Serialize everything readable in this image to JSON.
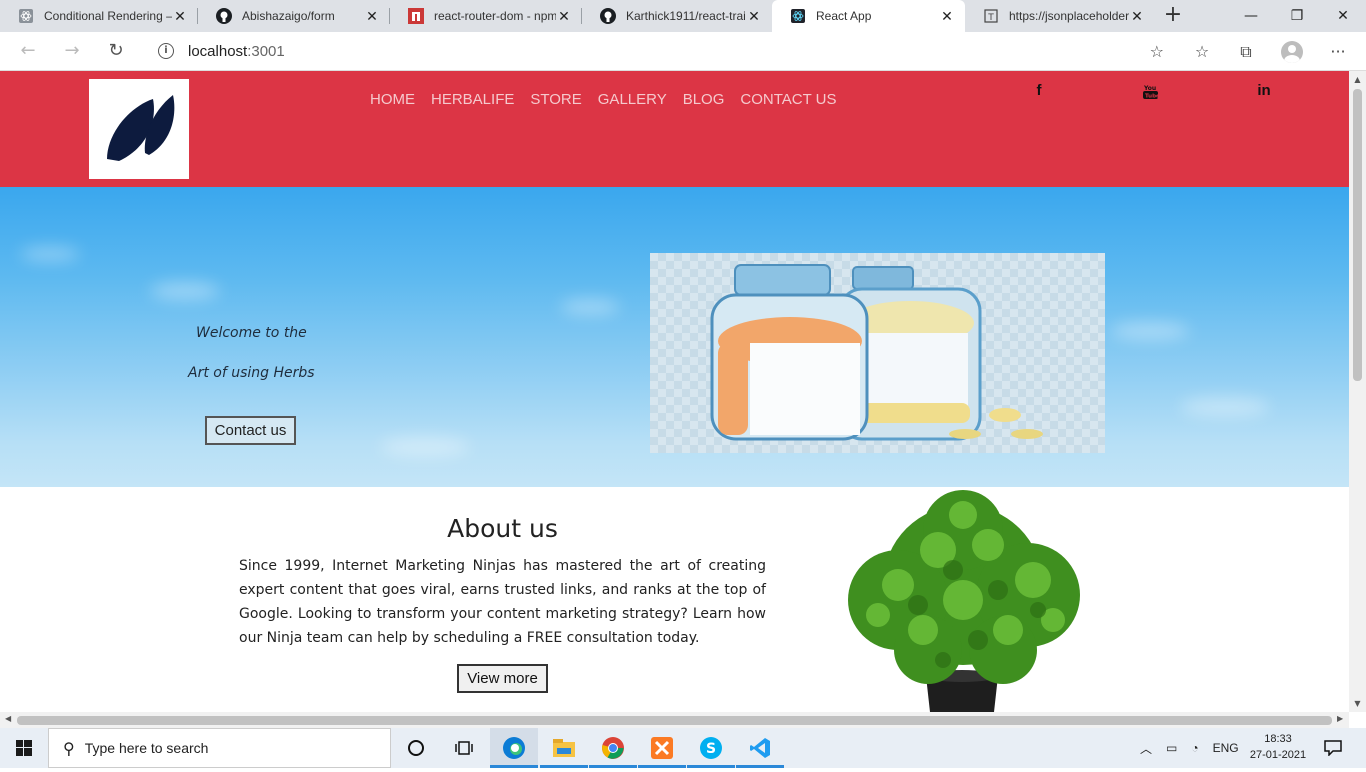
{
  "browser": {
    "tabs": [
      {
        "title": "Conditional Rendering –",
        "favicon": "react-icon"
      },
      {
        "title": "Abishazaigo/form",
        "favicon": "github-icon"
      },
      {
        "title": "react-router-dom - npm",
        "favicon": "npm-icon"
      },
      {
        "title": "Karthick1911/react-trai",
        "favicon": "github-icon"
      },
      {
        "title": "React App",
        "favicon": "react-icon"
      },
      {
        "title": "https://jsonplaceholder.",
        "favicon": "page-icon"
      }
    ],
    "active_tab_index": 4,
    "url_host": "localhost",
    "url_port": ":3001"
  },
  "site": {
    "nav": [
      "HOME",
      "HERBALIFE",
      "STORE",
      "GALLERY",
      "BLOG",
      "CONTACT US"
    ],
    "social": {
      "facebook": "f",
      "linkedin": "in"
    },
    "hero": {
      "line1": "Welcome to the",
      "line2": "Art of using Herbs",
      "button": "Contact us"
    },
    "about": {
      "title": "About us",
      "text": "Since 1999, Internet Marketing Ninjas has mastered the art of creating expert content that goes viral, earns trusted links, and ranks at the top of Google. Looking to transform your content marketing strategy? Learn how our Ninja team can help by scheduling a FREE consultation today.",
      "button": "View more"
    },
    "colors": {
      "header": "#dc3545",
      "logo_leaf": "#0d1b3e"
    }
  },
  "taskbar": {
    "search_placeholder": "Type here to search",
    "language": "ENG",
    "time": "18:33",
    "date": "27-01-2021"
  }
}
